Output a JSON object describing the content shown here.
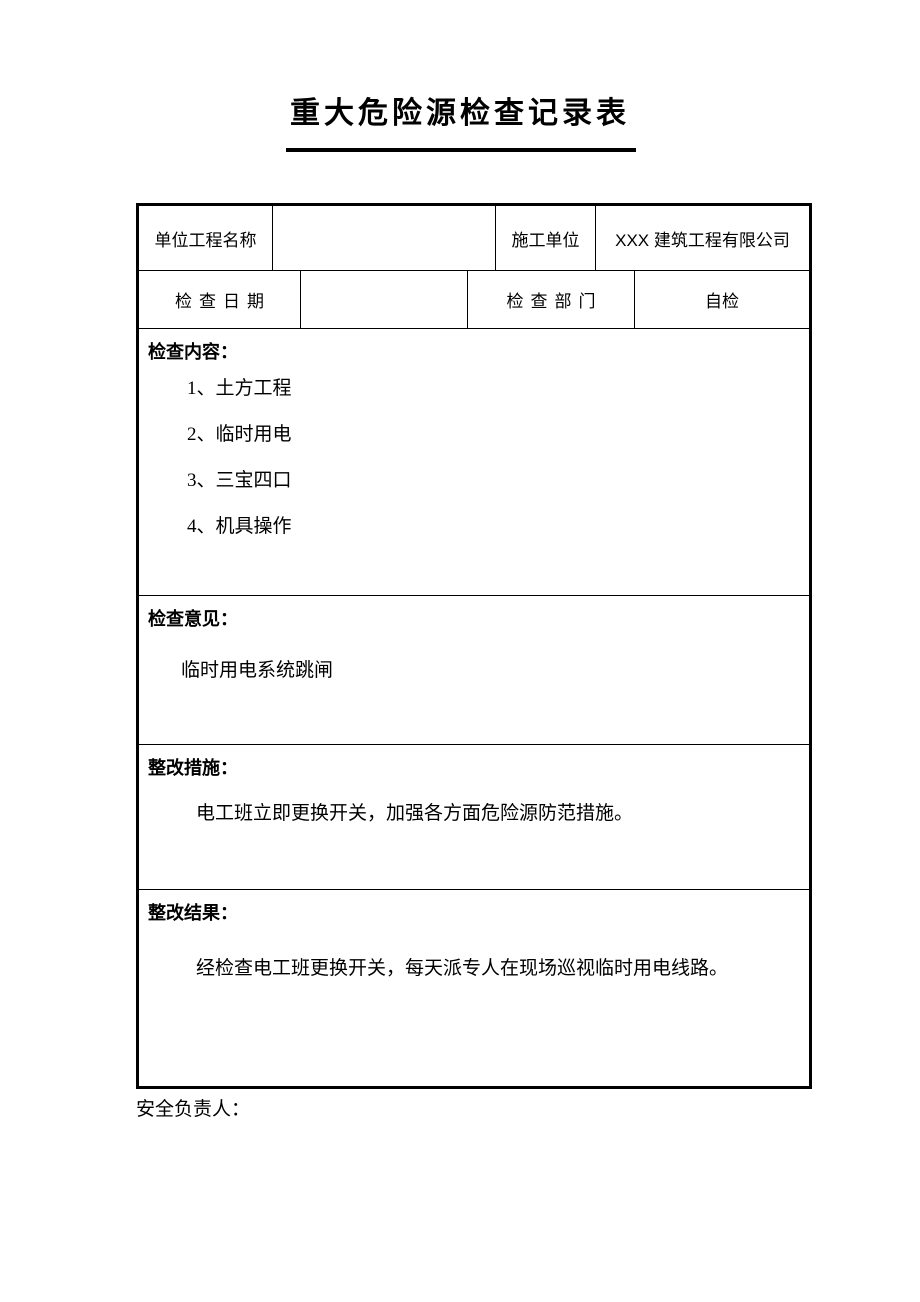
{
  "document": {
    "title": "重大危险源检查记录表"
  },
  "header_rows": {
    "row1": {
      "label_project": "单位工程名称",
      "value_project": "",
      "label_unit": "施工单位",
      "value_unit": "XXX 建筑工程有限公司"
    },
    "row2": {
      "label_date": "检查日期",
      "value_date": "",
      "label_dept": "检查部门",
      "value_dept": "自检"
    }
  },
  "sections": {
    "content": {
      "title": "检查内容：",
      "items": [
        "1、土方工程",
        "2、临时用电",
        "3、三宝四口",
        "4、机具操作"
      ]
    },
    "opinion": {
      "title": "检查意见：",
      "body": "临时用电系统跳闸"
    },
    "measure": {
      "title": "整改措施：",
      "body": "电工班立即更换开关，加强各方面危险源防范措施。"
    },
    "result": {
      "title": "整改结果：",
      "body": "经检查电工班更换开关，每天派专人在现场巡视临时用电线路。"
    }
  },
  "footer": {
    "signature_label": "安全负责人："
  }
}
